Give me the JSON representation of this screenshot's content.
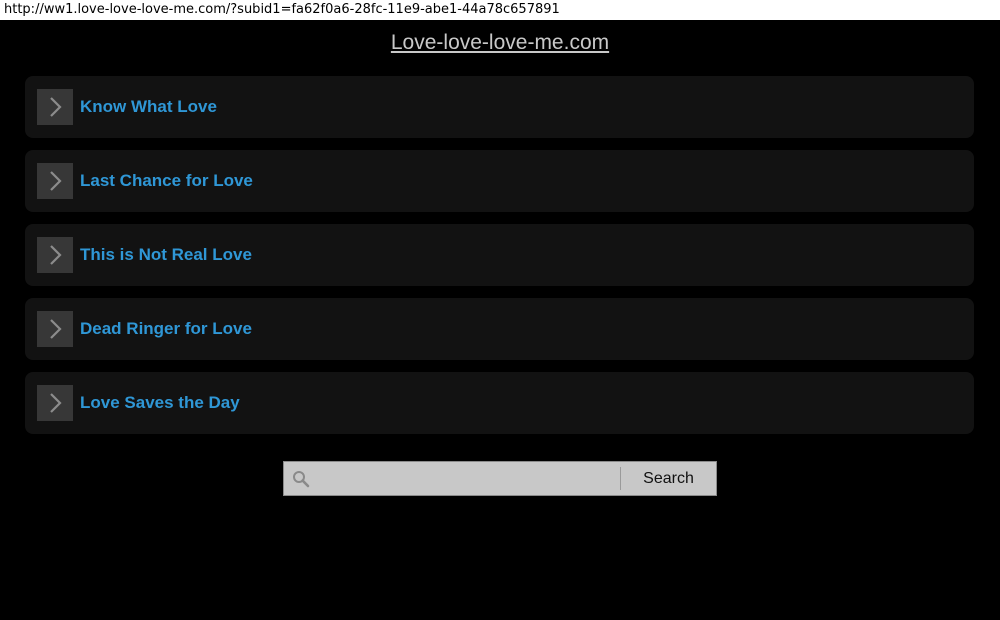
{
  "browser": {
    "url": "http://ww1.love-love-love-me.com/?subid1=fa62f0a6-28fc-11e9-abe1-44a78c657891"
  },
  "site": {
    "title": "Love-love-love-me.com"
  },
  "links": [
    {
      "label": "Know What Love",
      "icon": "chevron-right-icon"
    },
    {
      "label": "Last Chance for Love",
      "icon": "chevron-right-icon"
    },
    {
      "label": "This is Not Real Love",
      "icon": "chevron-right-icon"
    },
    {
      "label": "Dead Ringer for Love",
      "icon": "chevron-right-icon"
    },
    {
      "label": "Love Saves the Day",
      "icon": "chevron-right-icon"
    }
  ],
  "search": {
    "placeholder": "",
    "value": "",
    "button_label": "Search",
    "icon": "search-icon"
  },
  "colors": {
    "background": "#000000",
    "link_text": "#2f97d6",
    "link_card": "#121212",
    "arrow_box": "#373737",
    "search_bg": "#c8c8c8"
  }
}
